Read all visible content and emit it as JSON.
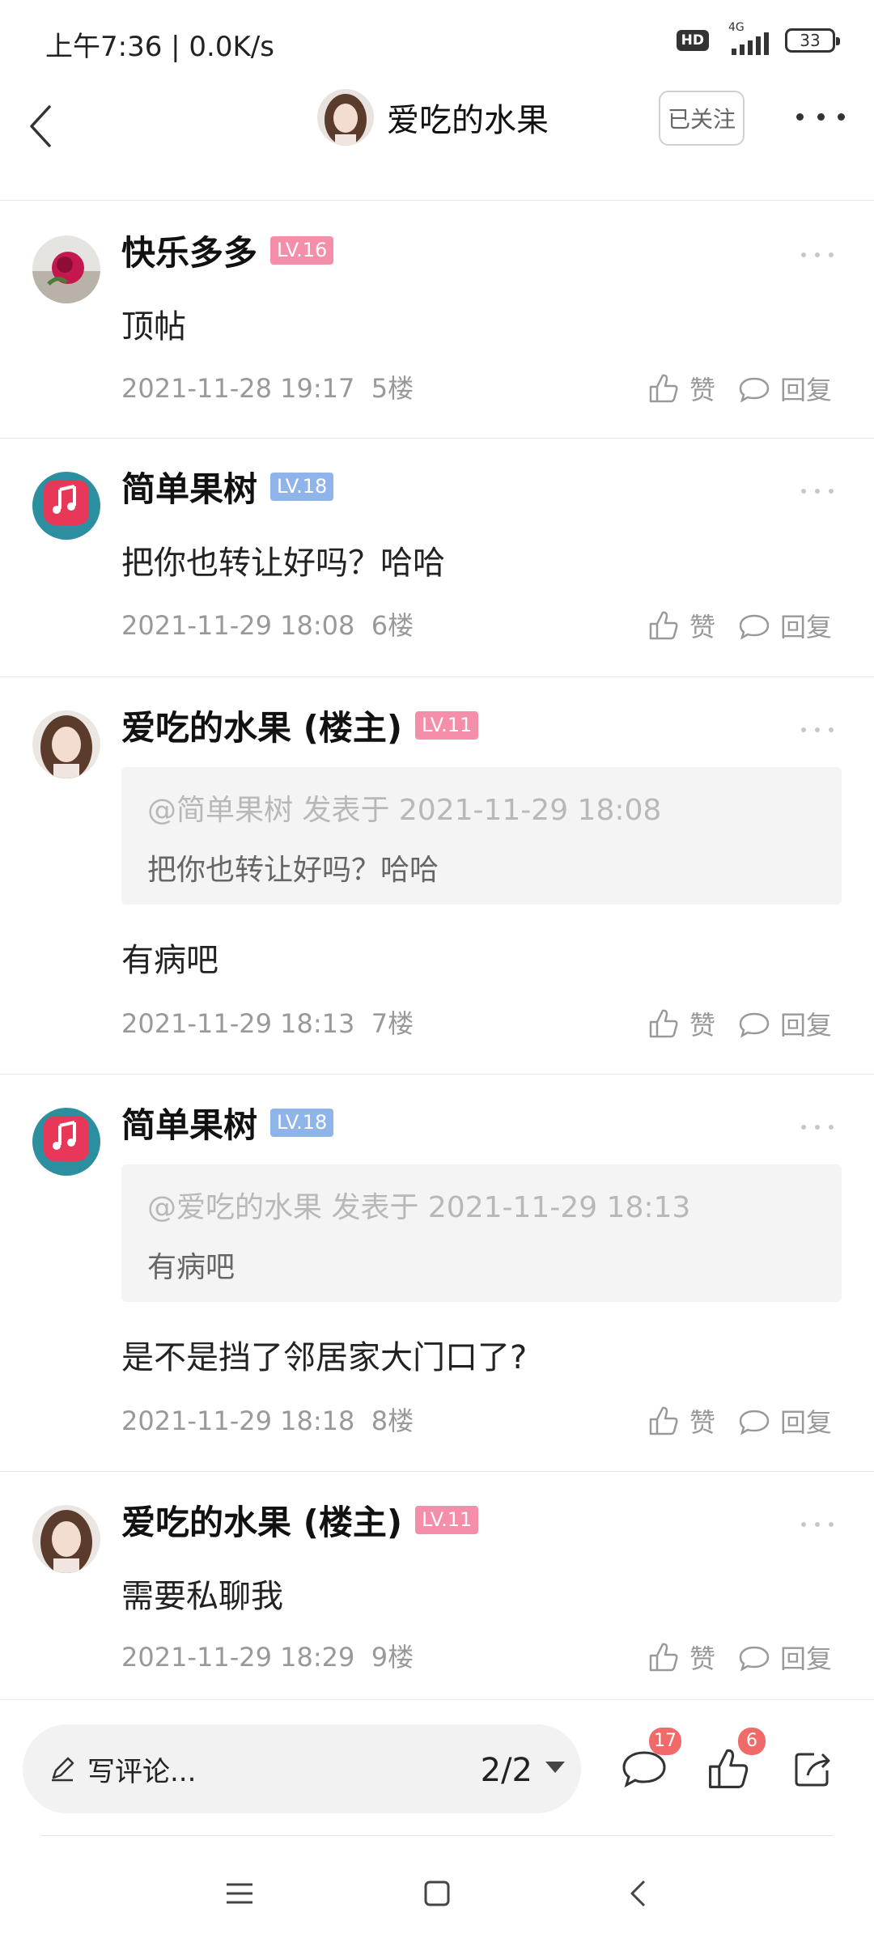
{
  "status_bar": {
    "time": "上午7:36 | 0.0K/s",
    "hd": "HD",
    "network": "4G",
    "battery": "33"
  },
  "header": {
    "title": "爱吃的水果",
    "follow_label": "已关注"
  },
  "comments": [
    {
      "username": "快乐多多",
      "level": "LV.16",
      "content": "顶帖",
      "date": "2021-11-28 19:17",
      "floor": "5楼",
      "like_label": "赞",
      "reply_label": "回复"
    },
    {
      "username": "简单果树",
      "level": "LV.18",
      "content": "把你也转让好吗？哈哈",
      "date": "2021-11-29 18:08",
      "floor": "6楼",
      "like_label": "赞",
      "reply_label": "回复"
    },
    {
      "username": "爱吃的水果 (楼主)",
      "level": "LV.11",
      "quote_head": "@简单果树 发表于 2021-11-29 18:08",
      "quote_text": "把你也转让好吗？哈哈",
      "content": "有病吧",
      "date": "2021-11-29 18:13",
      "floor": "7楼",
      "like_label": "赞",
      "reply_label": "回复"
    },
    {
      "username": "简单果树",
      "level": "LV.18",
      "quote_head": "@爱吃的水果 发表于 2021-11-29 18:13",
      "quote_text": "有病吧",
      "content": "是不是挡了邻居家大门口了?",
      "date": "2021-11-29 18:18",
      "floor": "8楼",
      "like_label": "赞",
      "reply_label": "回复"
    },
    {
      "username": "爱吃的水果 (楼主)",
      "level": "LV.11",
      "content": "需要私聊我",
      "date": "2021-11-29 18:29",
      "floor": "9楼",
      "like_label": "赞",
      "reply_label": "回复"
    }
  ],
  "bottom_bar": {
    "placeholder": "写评论...",
    "page_indicator": "2/2",
    "comment_count": "17",
    "like_count": "6"
  },
  "colors": {
    "level_pink": "#f58ea9",
    "level_blue": "#8eb4ea",
    "badge_red": "#f06a6a"
  }
}
